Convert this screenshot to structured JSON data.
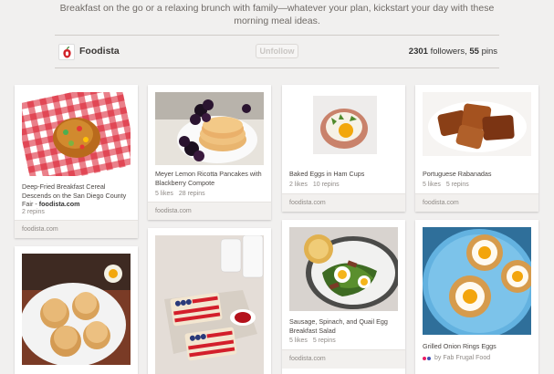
{
  "board": {
    "description": "Breakfast on the go or a relaxing brunch with family—whatever your plan, kickstart your day with these morning meal ideas.",
    "owner": "Foodista",
    "unfollow_label": "Unfollow",
    "followers_count": "2301",
    "followers_label": "followers,",
    "pins_count": "55",
    "pins_label": "pins"
  },
  "pins": [
    {
      "title_lead": "Deep-Fried Breakfast Cereal Descends on the San Diego County Fair - ",
      "title_link": "foodista.com",
      "repins": "2 repins",
      "source": "foodista.com",
      "image": "fried-cereal-ball"
    },
    {
      "title": "Meyer Lemon Ricotta Pancakes with Blackberry Compote",
      "likes": "5 likes",
      "repins": "28 repins",
      "source": "foodista.com",
      "image": "pancakes-blackberries"
    },
    {
      "title": "Baked Eggs in Ham Cups",
      "likes": "2 likes",
      "repins": "10 repins",
      "source": "foodista.com",
      "image": "ham-cup-egg"
    },
    {
      "title": "Portuguese Rabanadas",
      "likes": "5 likes",
      "repins": "5 repins",
      "source": "foodista.com",
      "image": "rabanadas"
    },
    {
      "image": "biscuits-plate"
    },
    {
      "image": "flag-toast"
    },
    {
      "title": "Sausage, Spinach, and Quail Egg Breakfast Salad",
      "likes": "5 likes",
      "repins": "5 repins",
      "source": "foodista.com",
      "image": "quail-egg-salad"
    },
    {
      "title": "Grilled Onion Rings Eggs",
      "via_prefix": "by",
      "via_name": "Fab Frugal Food",
      "image": "onion-ring-eggs"
    }
  ]
}
